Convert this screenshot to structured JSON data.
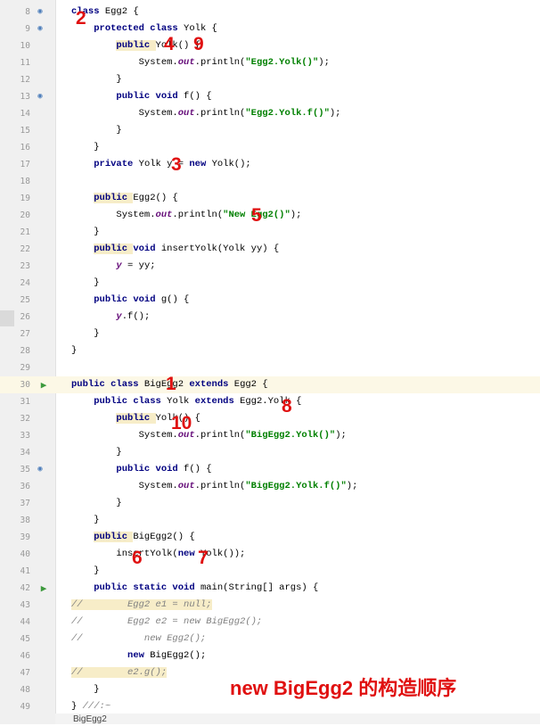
{
  "colors": {
    "annotation": "#e01010",
    "keyword": "#000080",
    "string": "#008000",
    "field": "#660e7a",
    "comment": "#808080"
  },
  "lines": [
    {
      "n": "8",
      "segs": [
        [
          "kw",
          "class "
        ],
        [
          "",
          "Egg2 {"
        ]
      ]
    },
    {
      "n": "9",
      "segs": [
        [
          "",
          "    "
        ],
        [
          "kw",
          "protected class "
        ],
        [
          "",
          "Yolk {"
        ]
      ]
    },
    {
      "n": "10",
      "segs": [
        [
          "",
          "        "
        ],
        [
          "kw hl",
          "public "
        ],
        [
          "",
          "Yolk() {"
        ]
      ]
    },
    {
      "n": "11",
      "segs": [
        [
          "",
          "            System."
        ],
        [
          "fld",
          "out"
        ],
        [
          "",
          ".println("
        ],
        [
          "str",
          "\"Egg2.Yolk()\""
        ],
        [
          "",
          ");"
        ]
      ]
    },
    {
      "n": "12",
      "segs": [
        [
          "",
          "        }"
        ]
      ]
    },
    {
      "n": "13",
      "segs": [
        [
          "",
          "        "
        ],
        [
          "kw",
          "public void "
        ],
        [
          "",
          "f() {"
        ]
      ]
    },
    {
      "n": "14",
      "segs": [
        [
          "",
          "            System."
        ],
        [
          "fld",
          "out"
        ],
        [
          "",
          ".println("
        ],
        [
          "str",
          "\"Egg2.Yolk.f()\""
        ],
        [
          "",
          ");"
        ]
      ]
    },
    {
      "n": "15",
      "segs": [
        [
          "",
          "        }"
        ]
      ]
    },
    {
      "n": "16",
      "segs": [
        [
          "",
          "    }"
        ]
      ]
    },
    {
      "n": "17",
      "segs": [
        [
          "",
          "    "
        ],
        [
          "kw",
          "private "
        ],
        [
          "",
          "Yolk y = "
        ],
        [
          "kw",
          "new "
        ],
        [
          "",
          "Yolk();"
        ]
      ]
    },
    {
      "n": "18",
      "segs": [
        [
          "",
          ""
        ]
      ]
    },
    {
      "n": "19",
      "segs": [
        [
          "",
          "    "
        ],
        [
          "kw hl",
          "public "
        ],
        [
          "",
          "Egg2() {"
        ]
      ]
    },
    {
      "n": "20",
      "segs": [
        [
          "",
          "        System."
        ],
        [
          "fld",
          "out"
        ],
        [
          "",
          ".println("
        ],
        [
          "str",
          "\"New Egg2()\""
        ],
        [
          "",
          ");"
        ]
      ]
    },
    {
      "n": "21",
      "segs": [
        [
          "",
          "    }"
        ]
      ]
    },
    {
      "n": "22",
      "segs": [
        [
          "",
          "    "
        ],
        [
          "kw hl",
          "public "
        ],
        [
          "kw",
          "void "
        ],
        [
          "",
          "insertYolk(Yolk yy) {"
        ]
      ]
    },
    {
      "n": "23",
      "segs": [
        [
          "",
          "        "
        ],
        [
          "fld",
          "y"
        ],
        [
          "",
          " = yy;"
        ]
      ]
    },
    {
      "n": "24",
      "segs": [
        [
          "",
          "    }"
        ]
      ]
    },
    {
      "n": "25",
      "segs": [
        [
          "",
          "    "
        ],
        [
          "kw",
          "public void "
        ],
        [
          "",
          "g() {"
        ]
      ]
    },
    {
      "n": "26",
      "segs": [
        [
          "",
          "        "
        ],
        [
          "fld",
          "y"
        ],
        [
          "",
          ".f();"
        ]
      ]
    },
    {
      "n": "27",
      "segs": [
        [
          "",
          "    }"
        ]
      ]
    },
    {
      "n": "28",
      "segs": [
        [
          "",
          "}"
        ]
      ]
    },
    {
      "n": "29",
      "segs": [
        [
          "",
          ""
        ]
      ]
    },
    {
      "n": "30",
      "segs": [
        [
          "kw",
          "public class "
        ],
        [
          "",
          "BigEgg2 "
        ],
        [
          "kw",
          "extends "
        ],
        [
          "",
          "Egg2 {"
        ]
      ]
    },
    {
      "n": "31",
      "segs": [
        [
          "",
          "    "
        ],
        [
          "kw",
          "public class "
        ],
        [
          "",
          "Yolk "
        ],
        [
          "kw",
          "extends "
        ],
        [
          "",
          "Egg2.Yolk {"
        ]
      ]
    },
    {
      "n": "32",
      "segs": [
        [
          "",
          "        "
        ],
        [
          "kw hl",
          "public "
        ],
        [
          "",
          "Yolk() {"
        ]
      ]
    },
    {
      "n": "33",
      "segs": [
        [
          "",
          "            System."
        ],
        [
          "fld",
          "out"
        ],
        [
          "",
          ".println("
        ],
        [
          "str",
          "\"BigEgg2.Yolk()\""
        ],
        [
          "",
          ");"
        ]
      ]
    },
    {
      "n": "34",
      "segs": [
        [
          "",
          "        }"
        ]
      ]
    },
    {
      "n": "35",
      "segs": [
        [
          "",
          "        "
        ],
        [
          "kw",
          "public void "
        ],
        [
          "",
          "f() {"
        ]
      ]
    },
    {
      "n": "36",
      "segs": [
        [
          "",
          "            System."
        ],
        [
          "fld",
          "out"
        ],
        [
          "",
          ".println("
        ],
        [
          "str",
          "\"BigEgg2.Yolk.f()\""
        ],
        [
          "",
          ");"
        ]
      ]
    },
    {
      "n": "37",
      "segs": [
        [
          "",
          "        }"
        ]
      ]
    },
    {
      "n": "38",
      "segs": [
        [
          "",
          "    }"
        ]
      ]
    },
    {
      "n": "39",
      "segs": [
        [
          "",
          "    "
        ],
        [
          "kw hl",
          "public "
        ],
        [
          "",
          "BigEgg2() {"
        ]
      ]
    },
    {
      "n": "40",
      "segs": [
        [
          "",
          "        insertYolk("
        ],
        [
          "kw",
          "new "
        ],
        [
          "",
          "Yolk());"
        ]
      ]
    },
    {
      "n": "41",
      "segs": [
        [
          "",
          "    }"
        ]
      ]
    },
    {
      "n": "42",
      "segs": [
        [
          "",
          "    "
        ],
        [
          "kw",
          "public static void "
        ],
        [
          "",
          "main(String[] args) {"
        ]
      ]
    },
    {
      "n": "43",
      "segs": [
        [
          "cm hl",
          "//        Egg2 e1 = null;"
        ]
      ]
    },
    {
      "n": "44",
      "segs": [
        [
          "cm",
          "//        Egg2 e2 = new BigEgg2();"
        ]
      ]
    },
    {
      "n": "45",
      "segs": [
        [
          "cm",
          "//           new Egg2();"
        ]
      ]
    },
    {
      "n": "46",
      "segs": [
        [
          "",
          "          "
        ],
        [
          "kw",
          "new "
        ],
        [
          "",
          "BigEgg2();"
        ]
      ]
    },
    {
      "n": "47",
      "segs": [
        [
          "cm hl",
          "//        e2.g();"
        ]
      ]
    },
    {
      "n": "48",
      "segs": [
        [
          "",
          "    }"
        ]
      ]
    },
    {
      "n": "49",
      "segs": [
        [
          "",
          "} "
        ],
        [
          "cm",
          "///:~"
        ]
      ]
    }
  ],
  "annotations": [
    "2",
    "4",
    "9",
    "3",
    "5",
    "1",
    "8",
    "10",
    "6",
    "7"
  ],
  "caption": "new BigEgg2 的构造顺序",
  "status": "BigEgg2"
}
